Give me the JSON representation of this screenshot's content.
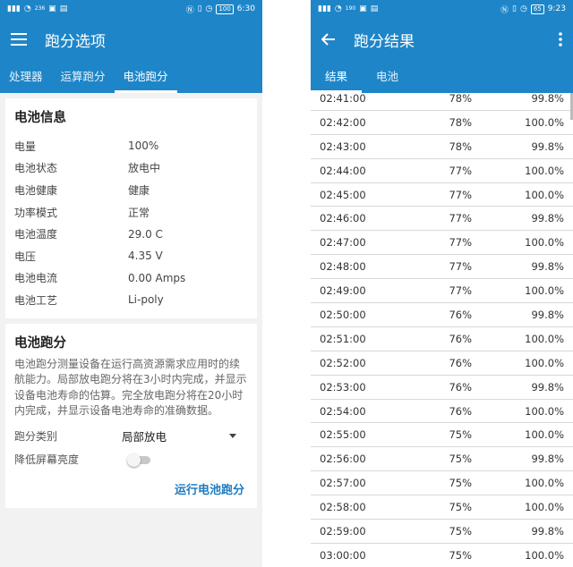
{
  "colors": {
    "primary": "#1e86c8",
    "accent": "#1e7cc0"
  },
  "left": {
    "status": {
      "left": "236",
      "right_badge": "100",
      "time": "6:30"
    },
    "title": "跑分选项",
    "tabs": [
      "处理器",
      "运算跑分",
      "电池跑分"
    ],
    "battery_info": {
      "title": "电池信息",
      "rows": [
        {
          "label": "电量",
          "value": "100%"
        },
        {
          "label": "电池状态",
          "value": "放电中"
        },
        {
          "label": "电池健康",
          "value": "健康"
        },
        {
          "label": "功率模式",
          "value": "正常"
        },
        {
          "label": "电池温度",
          "value": "29.0 C"
        },
        {
          "label": "电压",
          "value": "4.35 V"
        },
        {
          "label": "电池电流",
          "value": "0.00 Amps"
        },
        {
          "label": "电池工艺",
          "value": "Li-poly"
        }
      ]
    },
    "battery_bench": {
      "title": "电池跑分",
      "description": "电池跑分测量设备在运行高资源需求应用时的续航能力。局部放电跑分将在3小时内完成，并显示设备电池寿命的估算。完全放电跑分将在20小时内完成，并显示设备电池寿命的准确数据。",
      "type_label": "跑分类别",
      "type_value": "局部放电",
      "dim_label": "降低屏幕亮度",
      "dim_enabled": false,
      "run_button": "运行电池跑分"
    }
  },
  "right": {
    "status": {
      "left": "190",
      "right_badge": "65",
      "time": "9:23"
    },
    "title": "跑分结果",
    "tabs": [
      "结果",
      "电池"
    ],
    "rows": [
      {
        "time": "02:41:00",
        "pct": "78%",
        "health": "99.8%"
      },
      {
        "time": "02:42:00",
        "pct": "78%",
        "health": "100.0%"
      },
      {
        "time": "02:43:00",
        "pct": "78%",
        "health": "99.8%"
      },
      {
        "time": "02:44:00",
        "pct": "77%",
        "health": "100.0%"
      },
      {
        "time": "02:45:00",
        "pct": "77%",
        "health": "100.0%"
      },
      {
        "time": "02:46:00",
        "pct": "77%",
        "health": "99.8%"
      },
      {
        "time": "02:47:00",
        "pct": "77%",
        "health": "100.0%"
      },
      {
        "time": "02:48:00",
        "pct": "77%",
        "health": "99.8%"
      },
      {
        "time": "02:49:00",
        "pct": "77%",
        "health": "100.0%"
      },
      {
        "time": "02:50:00",
        "pct": "76%",
        "health": "99.8%"
      },
      {
        "time": "02:51:00",
        "pct": "76%",
        "health": "100.0%"
      },
      {
        "time": "02:52:00",
        "pct": "76%",
        "health": "100.0%"
      },
      {
        "time": "02:53:00",
        "pct": "76%",
        "health": "99.8%"
      },
      {
        "time": "02:54:00",
        "pct": "76%",
        "health": "100.0%"
      },
      {
        "time": "02:55:00",
        "pct": "75%",
        "health": "100.0%"
      },
      {
        "time": "02:56:00",
        "pct": "75%",
        "health": "99.8%"
      },
      {
        "time": "02:57:00",
        "pct": "75%",
        "health": "100.0%"
      },
      {
        "time": "02:58:00",
        "pct": "75%",
        "health": "100.0%"
      },
      {
        "time": "02:59:00",
        "pct": "75%",
        "health": "99.8%"
      },
      {
        "time": "03:00:00",
        "pct": "75%",
        "health": "100.0%"
      }
    ]
  }
}
